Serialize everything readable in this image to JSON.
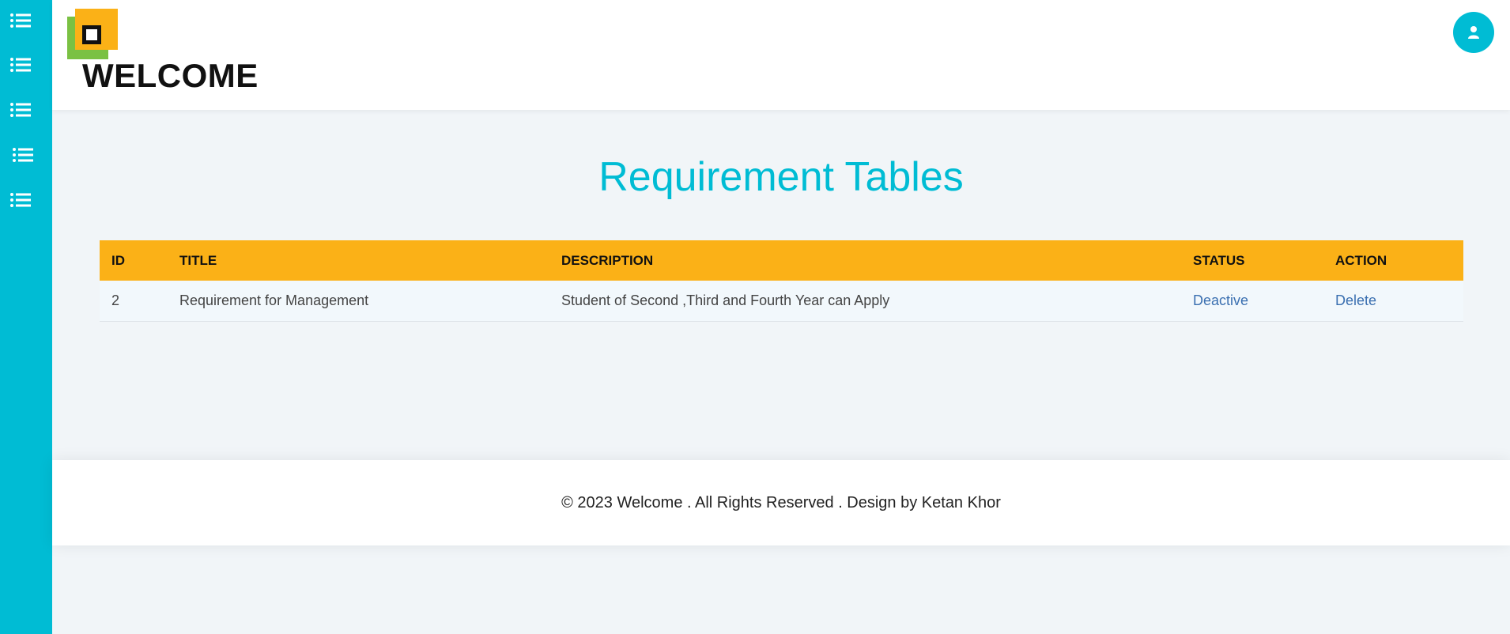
{
  "colors": {
    "accent": "#00bcd4",
    "table_header": "#fbb117",
    "link": "#3a6fb0",
    "logo_orange": "#fbb117",
    "logo_green": "#7ac143"
  },
  "sidebar": {
    "items": [
      {
        "icon": "list-icon"
      },
      {
        "icon": "list-icon"
      },
      {
        "icon": "list-icon"
      },
      {
        "icon": "list-icon"
      },
      {
        "icon": "list-icon"
      }
    ]
  },
  "header": {
    "brand": "WELCOME",
    "avatar_icon": "user-icon"
  },
  "main": {
    "title": "Requirement Tables",
    "table": {
      "columns": [
        "ID",
        "TITLE",
        "DESCRIPTION",
        "STATUS",
        "ACTION"
      ],
      "rows": [
        {
          "id": "2",
          "title": "Requirement for Management",
          "description": "Student of Second ,Third and Fourth Year can Apply",
          "status": "Deactive",
          "action": "Delete"
        }
      ]
    }
  },
  "footer": {
    "text": "© 2023 Welcome . All Rights Reserved . Design by Ketan Khor"
  }
}
